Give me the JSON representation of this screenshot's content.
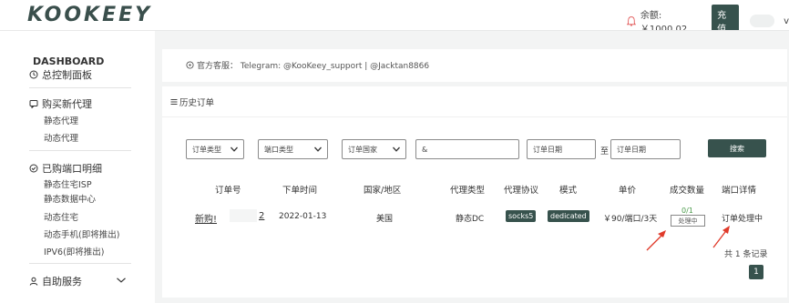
{
  "brand": {
    "logo_text": "KOOKEEY",
    "accent": "#37524d"
  },
  "header": {
    "balance_label": "余额: ￥1000.02",
    "recharge_label": "充值",
    "user_initial": "v",
    "bell_icon": "bell-icon"
  },
  "sidebar": {
    "dashboard_title": "DASHBOARD",
    "dashboard_label": "总控制面板",
    "buy_section": {
      "label": "购买新代理",
      "items": [
        "静态代理",
        "动态代理"
      ]
    },
    "owned_section": {
      "label": "已购端口明细",
      "items": [
        "静态住宅ISP",
        "静态数据中心",
        "动态住宅",
        "动态手机(即将推出)",
        "IPV6(即将推出)"
      ]
    },
    "self_service": {
      "label": "自助服务"
    }
  },
  "support": {
    "text": "官方客服： Telegram: @KooKeey_support | @Jacktan8866"
  },
  "history": {
    "title": "历史订单"
  },
  "filters": {
    "order_type": "订单类型",
    "port_type": "端口类型",
    "country": "订单国家",
    "search_value": "&",
    "date_from_placeholder": "订单日期",
    "to_label": "至",
    "date_to_placeholder": "订单日期",
    "search_button": "搜索"
  },
  "table": {
    "headers": [
      "订单号",
      "下单时间",
      "国家/地区",
      "代理类型",
      "代理协议",
      "模式",
      "单价",
      "成交数量",
      "端口详情"
    ],
    "row": {
      "order_prefix": "新购!",
      "order_suffix": "2",
      "time": "2022-01-13",
      "country": "美国",
      "proxy_type": "静态DC",
      "protocol": "socks5",
      "mode": "dedicated",
      "price": "￥90/端口/3天",
      "deal_count": "0/1",
      "deal_status": "处理中",
      "port_detail": "订单处理中"
    }
  },
  "pagination": {
    "total_text": "共 1 条记录",
    "current_page": "1"
  }
}
